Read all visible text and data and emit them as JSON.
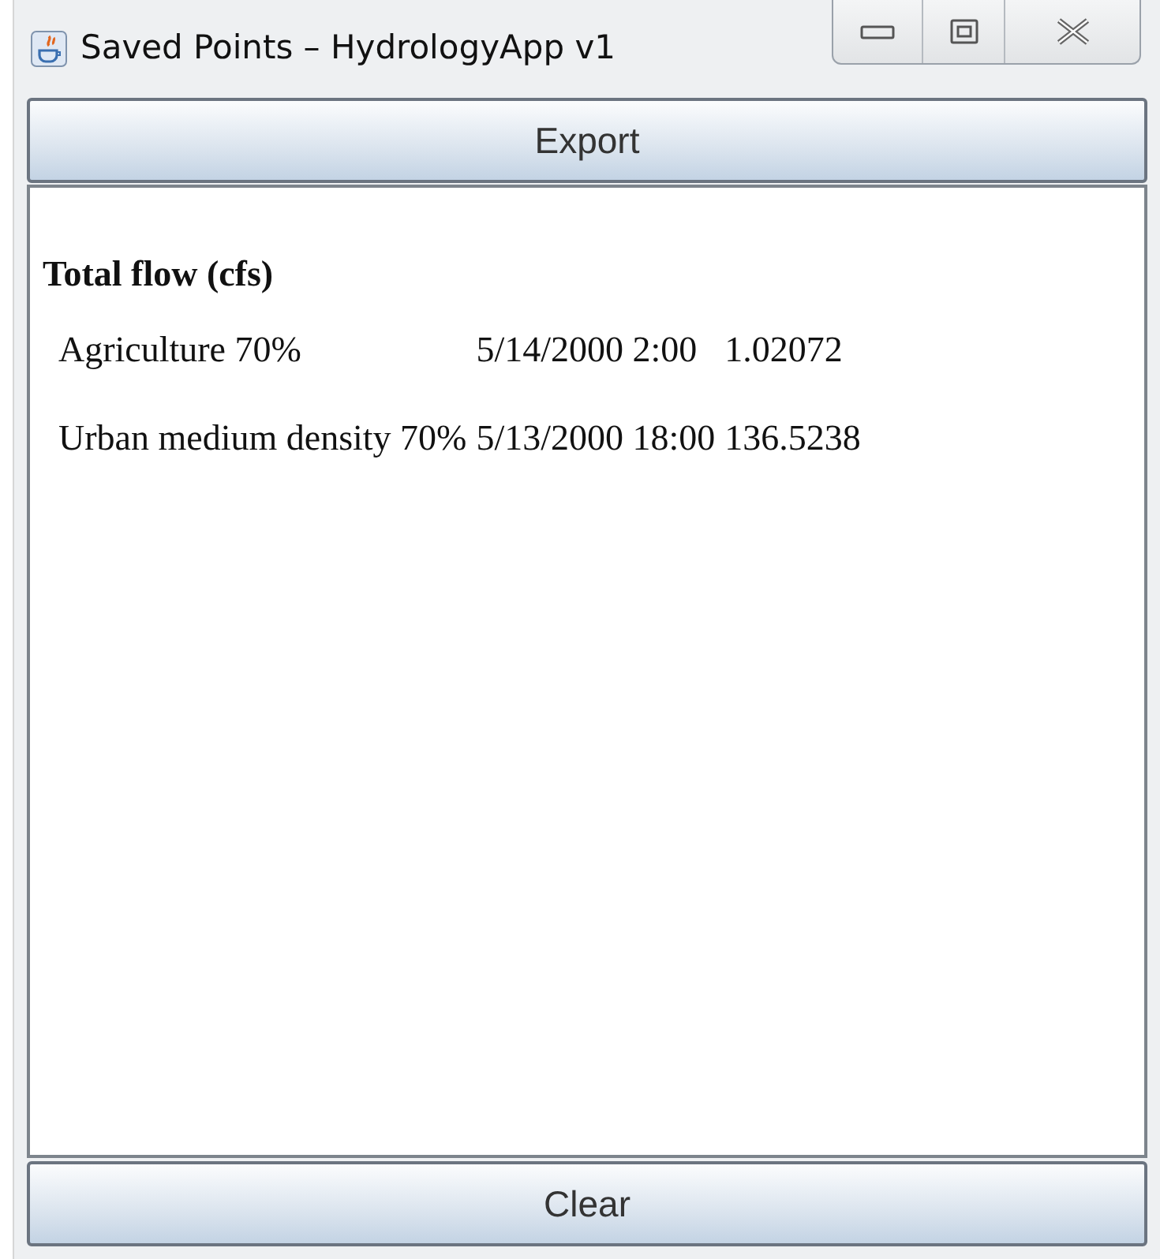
{
  "window": {
    "title": "Saved Points – HydrologyApp v1"
  },
  "buttons": [
    {
      "label": "Export"
    },
    {
      "label": "Clear"
    }
  ],
  "section": {
    "heading": "Total flow (cfs)",
    "rows": [
      {
        "name": "Agriculture 70%",
        "time": "5/14/2000 2:00",
        "value": "1.02072"
      },
      {
        "name": "Urban medium density 70%",
        "time": "5/13/2000 18:00",
        "value": "136.5238"
      }
    ]
  }
}
